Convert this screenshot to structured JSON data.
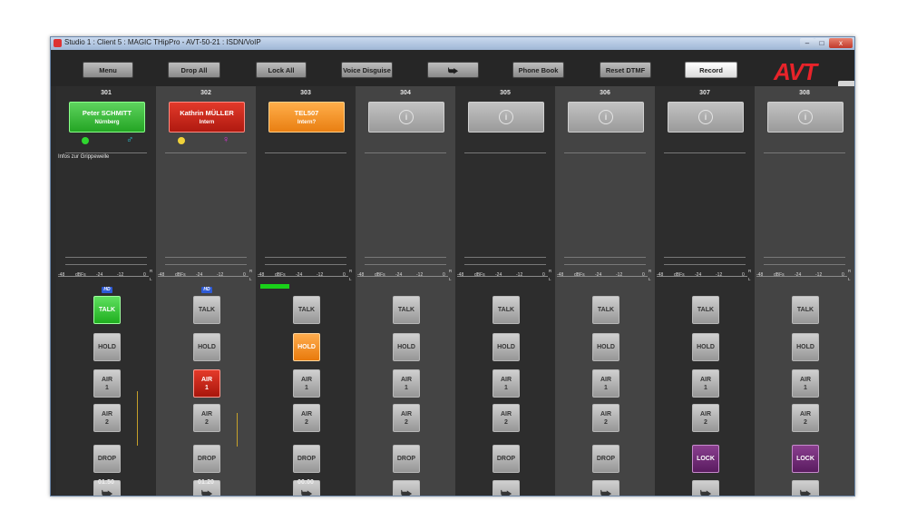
{
  "window": {
    "title": "Studio 1 : Client 5 : MAGIC THipPro - AVT-50-21 : ISDN/VoIP",
    "controls": {
      "minimize": "–",
      "maximize": "□",
      "close": "x"
    }
  },
  "toolbar": {
    "menu": "Menu",
    "drop_all": "Drop All",
    "lock_all": "Lock All",
    "voice_disguise": "Voice Disguise",
    "transfer": "⮩",
    "phone_book": "Phone Book",
    "reset_dtmf": "Reset DTMF",
    "record": "Record",
    "logo": "AVT"
  },
  "meter": {
    "ticks": [
      "-48",
      "dBFs",
      "-24",
      "-12",
      "0"
    ],
    "channel_labels": [
      "R",
      "L"
    ]
  },
  "keys": {
    "talk": "TALK",
    "hold": "HOLD",
    "air": "AIR",
    "drop": "DROP",
    "lock": "LOCK",
    "transfer_arrow": "⮩"
  },
  "lines": [
    {
      "number": "301",
      "caller_name": "Peter SCHMITT",
      "caller_sub": "Nürnberg",
      "caller_color": "#2fb52f",
      "state": "green",
      "info": "Infos zur Grippewelle",
      "hd": "HD",
      "talk_active": true,
      "hold_active": false,
      "air1_active": false,
      "timer": "01:50",
      "smiley": "☻",
      "gender": "♂",
      "gender_color": "#2ec9d6",
      "level_fraction": 0
    },
    {
      "number": "302",
      "caller_name": "Kathrin MÜLLER",
      "caller_sub": "Intern",
      "caller_color": "#c9261a",
      "state": "red",
      "info": "",
      "hd": "HD",
      "talk_active": false,
      "hold_active": false,
      "air1_active": true,
      "timer": "01:20",
      "smiley": "☻",
      "gender": "♀",
      "gender_color": "#e030d8",
      "level_fraction": 0
    },
    {
      "number": "303",
      "caller_name": "TEL507",
      "caller_sub": "Intern?",
      "caller_color": "#f5951e",
      "state": "orange",
      "info": "",
      "hd": "",
      "talk_active": false,
      "hold_active": true,
      "air1_active": false,
      "timer": "00:00",
      "smiley": "",
      "gender": "",
      "gender_color": "",
      "level_fraction": 0.32
    },
    {
      "number": "304",
      "state": "empty",
      "lock": false,
      "level_fraction": 0
    },
    {
      "number": "305",
      "state": "empty",
      "lock": false,
      "level_fraction": 0
    },
    {
      "number": "306",
      "state": "empty",
      "lock": false,
      "level_fraction": 0
    },
    {
      "number": "307",
      "state": "empty",
      "lock": true,
      "level_fraction": 0
    },
    {
      "number": "308",
      "state": "empty",
      "lock": true,
      "level_fraction": 0
    }
  ],
  "colors": {
    "accent_green": "#1fae1f",
    "accent_red": "#c9261a",
    "accent_orange": "#f5951e",
    "accent_purple": "#6b2a72",
    "logo_red": "#e8232a"
  },
  "icons": {
    "info": "info-icon",
    "transfer": "transfer-arrow-icon",
    "smiley": "smiley-icon",
    "gender_male": "male-icon",
    "gender_female": "female-icon"
  }
}
